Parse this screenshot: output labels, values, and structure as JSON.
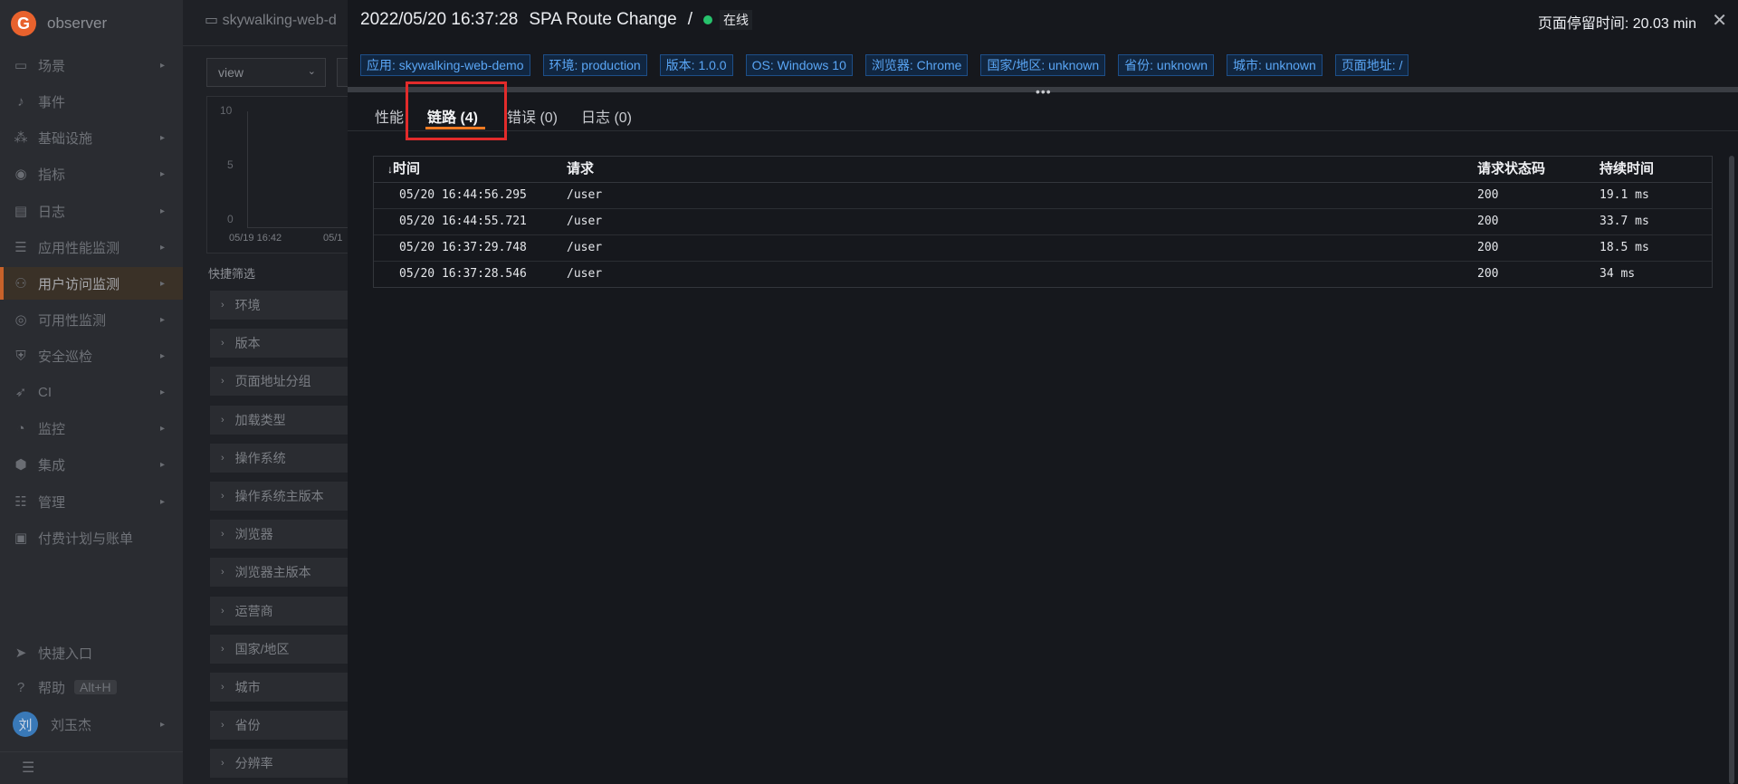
{
  "sidebar": {
    "brand": "observer",
    "items": [
      {
        "label": "场景",
        "icon": "scene-icon",
        "chevron": true
      },
      {
        "label": "事件",
        "icon": "bell-icon",
        "chevron": false
      },
      {
        "label": "基础设施",
        "icon": "infra-icon",
        "chevron": true
      },
      {
        "label": "指标",
        "icon": "metrics-icon",
        "chevron": true
      },
      {
        "label": "日志",
        "icon": "log-icon",
        "chevron": true
      },
      {
        "label": "应用性能监测",
        "icon": "apm-icon",
        "chevron": true
      },
      {
        "label": "用户访问监测",
        "icon": "rum-icon",
        "chevron": true,
        "active": true
      },
      {
        "label": "可用性监测",
        "icon": "availability-icon",
        "chevron": true
      },
      {
        "label": "安全巡检",
        "icon": "shield-icon",
        "chevron": true
      },
      {
        "label": "CI",
        "icon": "rocket-icon",
        "chevron": true
      },
      {
        "label": "监控",
        "icon": "monitor-icon",
        "chevron": true
      },
      {
        "label": "集成",
        "icon": "integration-icon",
        "chevron": true
      },
      {
        "label": "管理",
        "icon": "settings-icon",
        "chevron": true
      },
      {
        "label": "付费计划与账单",
        "icon": "billing-icon",
        "chevron": false
      }
    ],
    "quick_entry": "快捷入口",
    "help": "帮助",
    "help_shortcut": "Alt+H",
    "user_avatar": "刘",
    "user_name": "刘玉杰"
  },
  "middle": {
    "tab_title": "skywalking-web-d",
    "view_select": "view",
    "chart_y_ticks": [
      "10",
      "5",
      "0"
    ],
    "chart_x_ticks": [
      "05/19 16:42",
      "05/1"
    ],
    "quick_filter_title": "快捷筛选",
    "filters": [
      "环境",
      "版本",
      "页面地址分组",
      "加载类型",
      "操作系统",
      "操作系统主版本",
      "浏览器",
      "浏览器主版本",
      "运营商",
      "国家/地区",
      "城市",
      "省份",
      "分辨率"
    ]
  },
  "drawer": {
    "timestamp": "2022/05/20 16:37:28",
    "event": "SPA Route Change",
    "separator": "/",
    "status": "在线",
    "status_color": "#27c26c",
    "stay_time": "页面停留时间: 20.03 min",
    "tags": [
      "应用: skywalking-web-demo",
      "环境: production",
      "版本: 1.0.0",
      "OS: Windows 10",
      "浏览器: Chrome",
      "国家/地区: unknown",
      "省份: unknown",
      "城市: unknown",
      "页面地址: /"
    ],
    "tabs": [
      "性能",
      "链路 (4)",
      "错误 (0)",
      "日志 (0)"
    ],
    "active_tab": "链路 (4)",
    "accent": "#f07a22",
    "highlight_color": "#e22b2b"
  },
  "trace_table": {
    "sort_icon": "sort-down-icon",
    "columns": [
      "时间",
      "请求",
      "请求状态码",
      "持续时间"
    ],
    "rows": [
      [
        "05/20 16:44:56.295",
        "/user",
        "200",
        "19.1 ms"
      ],
      [
        "05/20 16:44:55.721",
        "/user",
        "200",
        "33.7 ms"
      ],
      [
        "05/20 16:37:29.748",
        "/user",
        "200",
        "18.5 ms"
      ],
      [
        "05/20 16:37:28.546",
        "/user",
        "200",
        "34 ms"
      ]
    ]
  }
}
